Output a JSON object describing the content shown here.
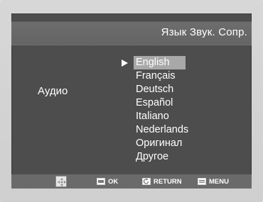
{
  "header": {
    "title": "Язык Звук. Сопр."
  },
  "setting": {
    "label": "Аудио"
  },
  "options": {
    "selected_index": 0,
    "items": [
      "English",
      "Français",
      "Deutsch",
      "Español",
      "Italiano",
      "Nederlands",
      "Оригинал",
      "Другое"
    ]
  },
  "footer": {
    "ok_label": "OK",
    "return_label": "RETURN",
    "menu_label": "MENU"
  },
  "colors": {
    "background": "#4d4d4d",
    "header": "#6a6a6a",
    "selected": "#a8a8a8",
    "text": "#ffffff"
  },
  "icons": {
    "selection": "triangle-right-icon",
    "navigate": "navigation-pad-icon",
    "ok": "ok-icon",
    "return": "return-icon",
    "menu": "menu-icon"
  }
}
